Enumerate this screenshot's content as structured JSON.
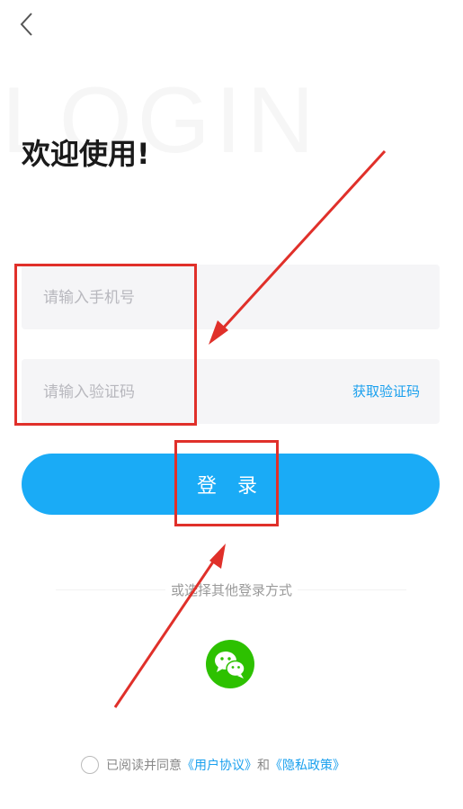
{
  "header": {
    "back_icon": "chevron-left-icon"
  },
  "watermark": "LOGIN",
  "title": "欢迎使用!",
  "phone": {
    "placeholder": "请输入手机号"
  },
  "code": {
    "placeholder": "请输入验证码",
    "get_code_label": "获取验证码"
  },
  "login_label": "登 录",
  "other_login": {
    "label": "或选择其他登录方式",
    "wechat_icon": "wechat-icon"
  },
  "agreement": {
    "prefix": "已阅读并同意",
    "user_agreement": "《用户协议》",
    "and": "和",
    "privacy_policy": "《隐私政策》"
  },
  "colors": {
    "accent": "#1aabf6",
    "link": "#1aa0ee",
    "wechat": "#2dc100",
    "annotation": "#e0302a"
  }
}
